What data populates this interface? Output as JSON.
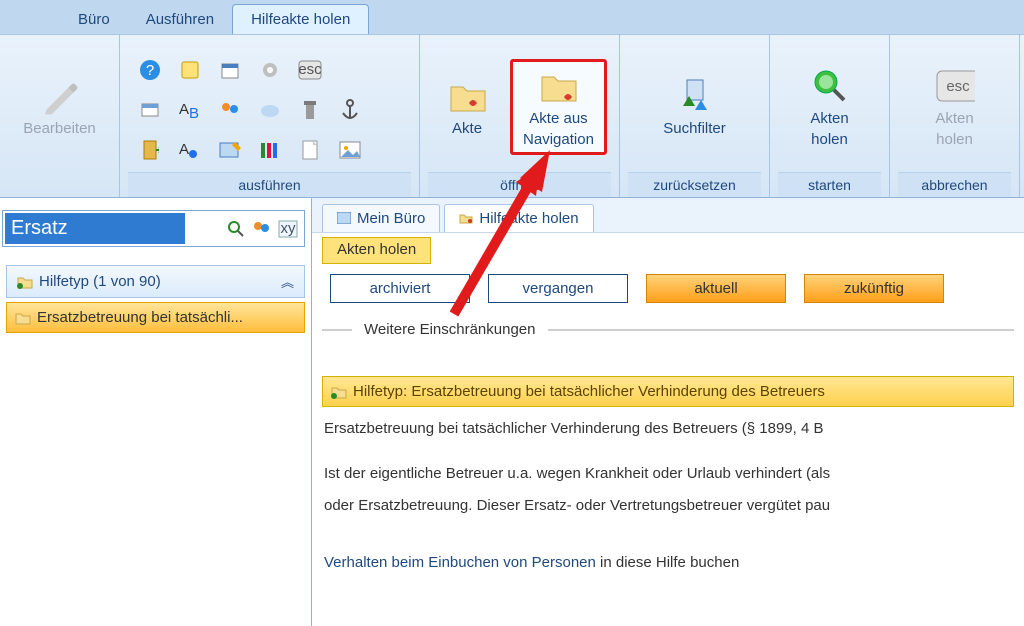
{
  "tabs": {
    "buero": "Büro",
    "ausfuehren": "Ausführen",
    "hilfeakte": "Hilfeakte holen"
  },
  "ribbon": {
    "bearbeiten_label": "Bearbeiten",
    "group_ausfuehren": "ausführen",
    "akte": "Akte",
    "akte_nav_l1": "Akte aus",
    "akte_nav_l2": "Navigation",
    "group_oeffnen": "öffnen",
    "suchfilter": "Suchfilter",
    "group_reset": "zurücksetzen",
    "akten_l1": "Akten",
    "akten_l2": "holen",
    "group_start": "starten",
    "akten_abbr_l1": "Akten",
    "akten_abbr_l2": "holen",
    "group_abbrechen": "abbrechen"
  },
  "search": {
    "value": "Ersatz"
  },
  "left": {
    "panel_title": "Hilfetyp (1 von 90)",
    "item1": "Ersatzbetreuung bei tatsächli..."
  },
  "inner_tabs": {
    "mein_buero": "Mein Büro",
    "hilfeakte": "Hilfeakte holen"
  },
  "filters": {
    "title": "Akten holen",
    "archiviert": "archiviert",
    "vergangen": "vergangen",
    "aktuell": "aktuell",
    "zukuenftig": "zukünftig",
    "weitere": "Weitere Einschränkungen"
  },
  "detail": {
    "heading": "Hilfetyp: Ersatzbetreuung bei tatsächlicher Verhinderung des Betreuers",
    "line1": "Ersatzbetreuung bei tatsächlicher Verhinderung des Betreuers (§ 1899, 4 B",
    "para1": "Ist der eigentliche Betreuer u.a. wegen Krankheit oder Urlaub verhindert (als",
    "para2": "oder Ersatzbetreuung. Dieser Ersatz- oder Vertretungsbetreuer vergütet pau",
    "link": "Verhalten beim Einbuchen von Personen",
    "tail": "  in diese Hilfe buchen"
  }
}
